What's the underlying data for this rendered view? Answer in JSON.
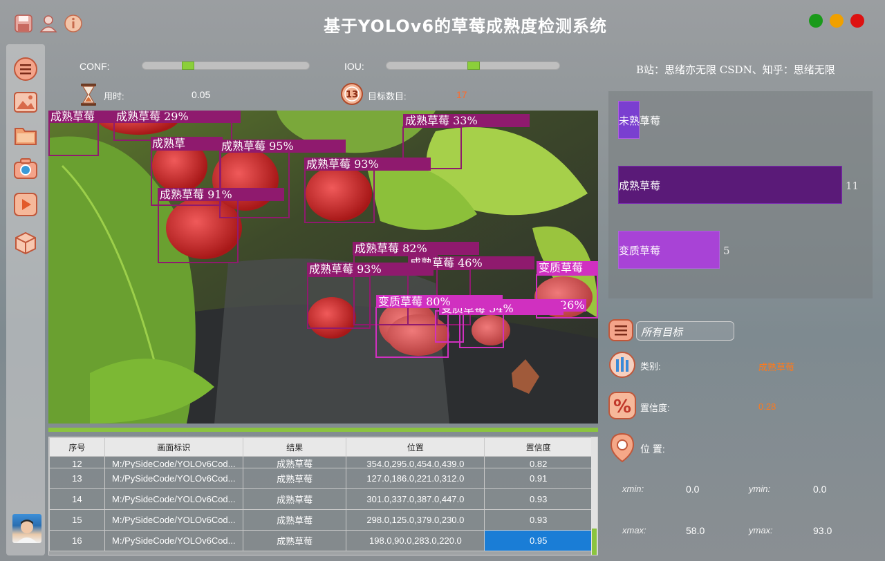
{
  "window": {
    "title": "基于YOLOv6的草莓成熟度检测系统",
    "toolbar_icons": [
      "save-icon",
      "user-icon",
      "info-icon"
    ],
    "controls": {
      "maximize": "#1a9a1a",
      "minimize": "#f0a000",
      "close": "#dd1111"
    }
  },
  "sidebar": {
    "items": [
      "menu-icon",
      "image-icon",
      "folder-icon",
      "camera-icon",
      "video-icon",
      "model-icon"
    ]
  },
  "params": {
    "conf_label": "CONF:",
    "iou_label": "IOU:",
    "conf_value": 0.3,
    "iou_value": 0.5,
    "time_label": "用时:",
    "time_value": "0.05",
    "count_label": "目标数目:",
    "count_value": "17",
    "count_badge": "13"
  },
  "credit": "B站：思绪亦无限  CSDN、知乎：思绪无限",
  "detections": [
    {
      "label": "成熟草莓 29%",
      "color": "#8f1a6e"
    },
    {
      "label": "成熟草莓 33%",
      "color": "#8f1a6e"
    },
    {
      "label": "成熟草莓",
      "color": "#8f1a6e"
    },
    {
      "label": "成熟草莓 95%",
      "color": "#8f1a6e"
    },
    {
      "label": "成熟草莓 93%",
      "color": "#8f1a6e"
    },
    {
      "label": "成熟草莓 91%",
      "color": "#8f1a6e"
    },
    {
      "label": "成熟草莓 82%",
      "color": "#8f1a6e"
    },
    {
      "label": "成熟草莓 93%",
      "color": "#8f1a6e"
    },
    {
      "label": "成熟草莓 46%",
      "color": "#8f1a6e"
    },
    {
      "label": "变质草莓",
      "color": "#d030c0"
    },
    {
      "label": "变质草莓 80%",
      "color": "#d030c0"
    },
    {
      "label": "变质草莓 54%",
      "color": "#d030c0"
    },
    {
      "label": "26%",
      "color": "#d030c0"
    },
    {
      "label": "成熟草",
      "color": "#8f1a6e"
    }
  ],
  "table": {
    "headers": [
      "序号",
      "画面标识",
      "结果",
      "位置",
      "置信度"
    ],
    "rows": [
      [
        "12",
        "M:/PySideCode/YOLOv6Cod...",
        "成熟草莓",
        "354.0,295.0,454.0,439.0",
        "0.82"
      ],
      [
        "13",
        "M:/PySideCode/YOLOv6Cod...",
        "成熟草莓",
        "127.0,186.0,221.0,312.0",
        "0.91"
      ],
      [
        "14",
        "M:/PySideCode/YOLOv6Cod...",
        "成熟草莓",
        "301.0,337.0,387.0,447.0",
        "0.93"
      ],
      [
        "15",
        "M:/PySideCode/YOLOv6Cod...",
        "成熟草莓",
        "298.0,125.0,379.0,230.0",
        "0.93"
      ],
      [
        "16",
        "M:/PySideCode/YOLOv6Cod...",
        "成熟草莓",
        "198.0,90.0,283.0,220.0",
        "0.95"
      ]
    ]
  },
  "chart_data": {
    "type": "bar",
    "categories": [
      "未熟草莓",
      "成熟草莓",
      "变质草莓"
    ],
    "values": [
      1,
      11,
      5
    ],
    "colors": [
      "#7a3fd0",
      "#5a1a78",
      "#a843d6"
    ]
  },
  "filter": {
    "value": "所有目标"
  },
  "info": {
    "class_label": "类别:",
    "class_value": "成熟草莓",
    "conf_label": "置信度:",
    "conf_value": "0.28",
    "pos_label": "位 置:",
    "xmin_label": "xmin:",
    "xmin_value": "0.0",
    "ymin_label": "ymin:",
    "ymin_value": "0.0",
    "xmax_label": "xmax:",
    "xmax_value": "58.0",
    "ymax_label": "ymax:",
    "ymax_value": "93.0"
  }
}
